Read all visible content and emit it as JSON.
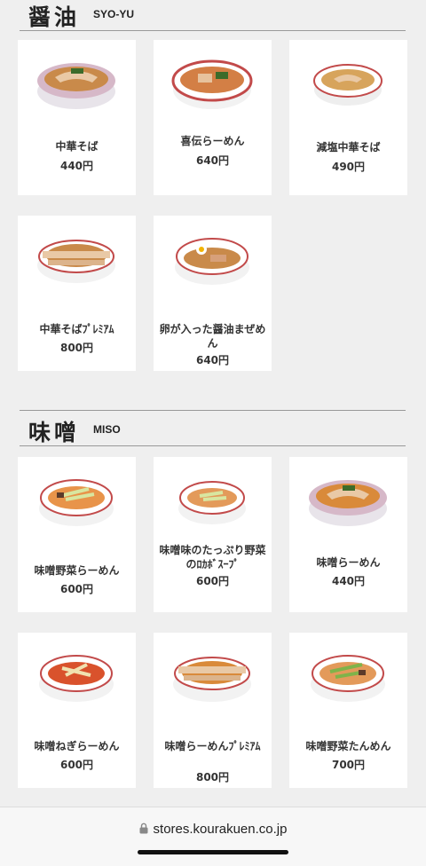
{
  "sections": [
    {
      "title": "醤油",
      "subtitle": "SYO-YU",
      "items": [
        {
          "name": "中華そば",
          "price": "440円",
          "icon": "ramen-bowl-icon"
        },
        {
          "name": "喜伝らーめん",
          "price": "640円",
          "icon": "ramen-bowl-icon"
        },
        {
          "name": "減塩中華そば",
          "price": "490円",
          "icon": "ramen-bowl-icon"
        },
        {
          "name": "中華そばﾌﾟﾚﾐｱﾑ",
          "price": "800円",
          "icon": "ramen-bowl-icon"
        },
        {
          "name": "卵が入った醤油まぜめん",
          "price": "640円",
          "icon": "ramen-bowl-icon"
        }
      ]
    },
    {
      "title": "味噌",
      "subtitle": "MISO",
      "items": [
        {
          "name": "味噌野菜らーめん",
          "price": "600円",
          "icon": "ramen-bowl-icon"
        },
        {
          "name": "味噌味のたっぷり野菜のﾛｶﾎﾞｽｰﾌﾟ",
          "price": "600円",
          "icon": "ramen-bowl-icon"
        },
        {
          "name": "味噌らーめん",
          "price": "440円",
          "icon": "ramen-bowl-icon"
        },
        {
          "name": "味噌ねぎらーめん",
          "price": "600円",
          "icon": "ramen-bowl-icon"
        },
        {
          "name": "味噌らーめんﾌﾟﾚﾐｱﾑ",
          "price": "800円",
          "icon": "ramen-bowl-icon"
        },
        {
          "name": "味噌野菜たんめん",
          "price": "700円",
          "icon": "ramen-bowl-icon"
        }
      ]
    }
  ],
  "browser": {
    "url": "stores.kourakuen.co.jp",
    "lock_icon": "lock-icon"
  },
  "colors": {
    "background": "#efefef",
    "card": "#ffffff",
    "broth_shoyu": "#c98a4a",
    "broth_miso": "#d98a3a",
    "bowl_rim": "#c24a4a"
  }
}
